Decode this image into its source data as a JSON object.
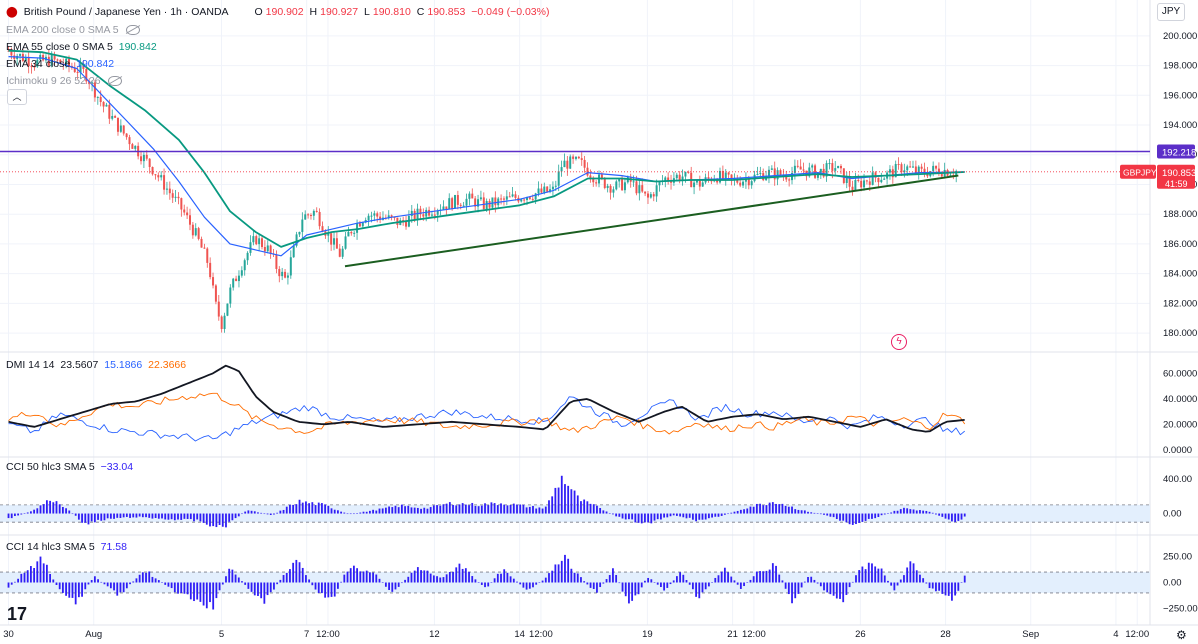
{
  "header": {
    "symbol_title": "British Pound / Japanese Yen · 1h · OANDA",
    "open_label": "O",
    "open_value": "190.902",
    "high_label": "H",
    "high_value": "190.927",
    "low_label": "L",
    "low_value": "190.810",
    "close_label": "C",
    "close_value": "190.853",
    "change": "−0.049 (−0.03%)",
    "currency_button": "JPY"
  },
  "legend": {
    "ema200_label": "EMA 200 close 0 SMA 5",
    "ema55_label": "EMA 55 close 0 SMA 5",
    "ema55_value": "190.842",
    "ema34_label": "EMA 34 close",
    "ema34_value": "190.842",
    "ichimoku_label": "Ichimoku 9 26 52 26",
    "collapse_icon": "chevron-up-icon",
    "visibility_icon": "eye-off-icon"
  },
  "price_axis": {
    "ticks": [
      "200.000",
      "198.000",
      "196.000",
      "194.000",
      "192.000",
      "190.000",
      "188.000",
      "186.000",
      "184.000",
      "182.000",
      "180.000"
    ],
    "tick_values": [
      200,
      198,
      196,
      194,
      192,
      190,
      188,
      186,
      184,
      182,
      180
    ],
    "ylim": [
      179.2,
      201.2
    ],
    "resistance_label": "192.218",
    "resistance_value": 192.218,
    "last_symbol": "GBPJPY",
    "last_price": "190.853",
    "last_price_value": 190.853,
    "countdown": "41:59"
  },
  "dmi": {
    "label": "DMI 14 14",
    "adx": "23.5607",
    "plus_di": "15.1866",
    "minus_di": "22.3666",
    "ticks": [
      "60.0000",
      "40.0000",
      "20.0000",
      "0.0000"
    ],
    "tick_values": [
      60,
      40,
      20,
      0
    ],
    "ylim": [
      -4,
      72
    ]
  },
  "cci50": {
    "label": "CCI 50 hlc3 SMA 5",
    "value": "−33.04",
    "ticks": [
      "400.00",
      "0.00"
    ],
    "tick_values": [
      400,
      0
    ],
    "band": [
      100,
      -100
    ],
    "ylim": [
      -190,
      560
    ]
  },
  "cci14": {
    "label": "CCI 14 hlc3 SMA 5",
    "value": "71.58",
    "ticks": [
      "250.00",
      "0.00",
      "−250.00"
    ],
    "tick_values": [
      250,
      0,
      -250
    ],
    "band": [
      100,
      -100
    ],
    "ylim": [
      -360,
      360
    ]
  },
  "time_axis": {
    "labels": [
      "30",
      "Aug",
      "5",
      "7",
      "12:00",
      "12",
      "14",
      "12:00",
      "19",
      "21",
      "12:00",
      "26",
      "28",
      "Sep",
      "4",
      "12:00"
    ],
    "positions": [
      0,
      2,
      5,
      7,
      7.5,
      10,
      12,
      12.5,
      15,
      17,
      17.5,
      20,
      22,
      24,
      26,
      26.5
    ]
  },
  "chart_data": {
    "type": "candlestick",
    "title": "British Pound / Japanese Yen · 1h · OANDA",
    "x_domain": [
      -0.2,
      26.8
    ],
    "last_bar_x": 22.45,
    "price_anchors": [
      [
        0,
        199.0
      ],
      [
        0.6,
        198.2
      ],
      [
        1.0,
        198.4
      ],
      [
        1.4,
        198.0
      ],
      [
        1.8,
        197.5
      ],
      [
        2.2,
        195.4
      ],
      [
        2.6,
        193.8
      ],
      [
        3.0,
        192.4
      ],
      [
        3.4,
        191.0
      ],
      [
        3.8,
        189.4
      ],
      [
        4.1,
        188.2
      ],
      [
        4.4,
        186.6
      ],
      [
        4.7,
        184.6
      ],
      [
        4.85,
        182.0
      ],
      [
        5.0,
        180.6
      ],
      [
        5.2,
        182.8
      ],
      [
        5.5,
        184.8
      ],
      [
        5.8,
        186.4
      ],
      [
        6.1,
        185.6
      ],
      [
        6.3,
        184.4
      ],
      [
        6.5,
        183.6
      ],
      [
        6.7,
        185.6
      ],
      [
        6.9,
        187.8
      ],
      [
        7.2,
        188.2
      ],
      [
        7.5,
        186.6
      ],
      [
        7.8,
        185.2
      ],
      [
        8.0,
        186.8
      ],
      [
        8.4,
        188.0
      ],
      [
        8.8,
        187.8
      ],
      [
        9.2,
        187.4
      ],
      [
        9.6,
        188.0
      ],
      [
        10.0,
        188.4
      ],
      [
        10.4,
        188.8
      ],
      [
        10.8,
        189.0
      ],
      [
        11.2,
        188.6
      ],
      [
        11.6,
        188.9
      ],
      [
        12.0,
        189.2
      ],
      [
        12.4,
        189.4
      ],
      [
        12.8,
        189.6
      ],
      [
        13.0,
        191.4
      ],
      [
        13.4,
        191.5
      ],
      [
        13.8,
        190.4
      ],
      [
        14.2,
        189.8
      ],
      [
        14.6,
        190.2
      ],
      [
        15.0,
        189.0
      ],
      [
        15.4,
        190.4
      ],
      [
        15.8,
        190.6
      ],
      [
        16.2,
        190.0
      ],
      [
        16.6,
        190.6
      ],
      [
        17.0,
        190.2
      ],
      [
        17.4,
        190.4
      ],
      [
        17.8,
        190.8
      ],
      [
        18.2,
        190.6
      ],
      [
        18.6,
        191.0
      ],
      [
        19.0,
        190.8
      ],
      [
        19.4,
        191.2
      ],
      [
        19.8,
        189.8
      ],
      [
        20.2,
        190.4
      ],
      [
        20.6,
        190.6
      ],
      [
        21.0,
        191.2
      ],
      [
        21.4,
        190.8
      ],
      [
        21.8,
        191.0
      ],
      [
        22.2,
        190.9
      ],
      [
        22.45,
        190.85
      ]
    ],
    "ema34_anchors": [
      [
        0,
        198.6
      ],
      [
        0.8,
        198.5
      ],
      [
        1.6,
        197.8
      ],
      [
        2.2,
        196.0
      ],
      [
        2.8,
        194.2
      ],
      [
        3.4,
        192.4
      ],
      [
        4.0,
        190.2
      ],
      [
        4.6,
        187.8
      ],
      [
        5.2,
        186.0
      ],
      [
        5.8,
        185.6
      ],
      [
        6.4,
        185.2
      ],
      [
        7.0,
        186.6
      ],
      [
        7.6,
        187.0
      ],
      [
        8.2,
        187.4
      ],
      [
        9.0,
        187.8
      ],
      [
        10.0,
        188.2
      ],
      [
        11.0,
        188.6
      ],
      [
        12.0,
        189.0
      ],
      [
        12.8,
        189.6
      ],
      [
        13.6,
        190.8
      ],
      [
        14.4,
        190.6
      ],
      [
        15.2,
        190.2
      ],
      [
        16.0,
        190.3
      ],
      [
        17.0,
        190.4
      ],
      [
        18.0,
        190.6
      ],
      [
        19.0,
        190.8
      ],
      [
        19.8,
        190.4
      ],
      [
        20.6,
        190.6
      ],
      [
        21.4,
        190.8
      ],
      [
        22.45,
        190.85
      ]
    ],
    "ema55_anchors": [
      [
        0,
        199.0
      ],
      [
        0.8,
        198.9
      ],
      [
        1.6,
        198.4
      ],
      [
        2.4,
        196.6
      ],
      [
        3.2,
        195.0
      ],
      [
        4.0,
        193.0
      ],
      [
        4.6,
        190.8
      ],
      [
        5.2,
        188.2
      ],
      [
        5.8,
        186.8
      ],
      [
        6.4,
        185.8
      ],
      [
        7.0,
        186.4
      ],
      [
        7.6,
        186.8
      ],
      [
        8.2,
        187.0
      ],
      [
        9.0,
        187.4
      ],
      [
        10.0,
        187.8
      ],
      [
        11.0,
        188.2
      ],
      [
        12.0,
        188.6
      ],
      [
        12.8,
        189.2
      ],
      [
        13.6,
        190.4
      ],
      [
        14.4,
        190.4
      ],
      [
        15.2,
        190.2
      ],
      [
        16.0,
        190.3
      ],
      [
        17.0,
        190.3
      ],
      [
        18.0,
        190.5
      ],
      [
        19.0,
        190.7
      ],
      [
        19.8,
        190.5
      ],
      [
        20.6,
        190.6
      ],
      [
        21.4,
        190.7
      ],
      [
        22.45,
        190.84
      ]
    ],
    "trendline": [
      [
        7.9,
        184.5
      ],
      [
        22.3,
        190.6
      ]
    ],
    "resistance": 192.218,
    "dmi_adx": [
      [
        0,
        22
      ],
      [
        0.6,
        18
      ],
      [
        1.2,
        24
      ],
      [
        1.8,
        30
      ],
      [
        2.4,
        36
      ],
      [
        3.0,
        38
      ],
      [
        3.6,
        44
      ],
      [
        4.2,
        52
      ],
      [
        4.8,
        60
      ],
      [
        5.1,
        66
      ],
      [
        5.4,
        62
      ],
      [
        5.8,
        42
      ],
      [
        6.2,
        30
      ],
      [
        6.8,
        22
      ],
      [
        7.4,
        20
      ],
      [
        8.0,
        22
      ],
      [
        8.8,
        18
      ],
      [
        9.6,
        20
      ],
      [
        10.4,
        22
      ],
      [
        11.2,
        20
      ],
      [
        12.0,
        18
      ],
      [
        12.6,
        16
      ],
      [
        13.2,
        38
      ],
      [
        13.6,
        40
      ],
      [
        14.2,
        30
      ],
      [
        14.8,
        22
      ],
      [
        15.4,
        30
      ],
      [
        15.8,
        34
      ],
      [
        16.4,
        22
      ],
      [
        17.0,
        26
      ],
      [
        17.6,
        28
      ],
      [
        18.2,
        24
      ],
      [
        18.8,
        26
      ],
      [
        19.4,
        22
      ],
      [
        20.0,
        18
      ],
      [
        20.6,
        24
      ],
      [
        21.2,
        16
      ],
      [
        21.6,
        14
      ],
      [
        22.0,
        22
      ],
      [
        22.45,
        23.5
      ]
    ],
    "dmi_plus": [
      [
        0,
        20
      ],
      [
        0.6,
        14
      ],
      [
        1.2,
        28
      ],
      [
        1.8,
        22
      ],
      [
        2.4,
        16
      ],
      [
        3.0,
        14
      ],
      [
        3.6,
        12
      ],
      [
        4.2,
        10
      ],
      [
        4.8,
        8
      ],
      [
        5.2,
        14
      ],
      [
        5.8,
        22
      ],
      [
        6.4,
        28
      ],
      [
        7.0,
        34
      ],
      [
        7.6,
        26
      ],
      [
        8.2,
        24
      ],
      [
        8.8,
        22
      ],
      [
        9.6,
        26
      ],
      [
        10.4,
        30
      ],
      [
        11.2,
        26
      ],
      [
        12.0,
        24
      ],
      [
        12.6,
        22
      ],
      [
        13.2,
        42
      ],
      [
        13.8,
        30
      ],
      [
        14.4,
        20
      ],
      [
        15.0,
        30
      ],
      [
        15.6,
        38
      ],
      [
        16.2,
        24
      ],
      [
        16.8,
        34
      ],
      [
        17.4,
        28
      ],
      [
        18.0,
        30
      ],
      [
        18.6,
        22
      ],
      [
        19.2,
        26
      ],
      [
        19.8,
        18
      ],
      [
        20.4,
        26
      ],
      [
        21.0,
        20
      ],
      [
        21.6,
        24
      ],
      [
        22.0,
        14
      ],
      [
        22.45,
        15.2
      ]
    ],
    "dmi_minus": [
      [
        0,
        24
      ],
      [
        0.6,
        30
      ],
      [
        1.2,
        18
      ],
      [
        1.8,
        28
      ],
      [
        2.4,
        36
      ],
      [
        3.0,
        34
      ],
      [
        3.6,
        38
      ],
      [
        4.2,
        42
      ],
      [
        4.8,
        44
      ],
      [
        5.2,
        38
      ],
      [
        5.8,
        24
      ],
      [
        6.4,
        18
      ],
      [
        7.0,
        14
      ],
      [
        7.6,
        20
      ],
      [
        8.2,
        22
      ],
      [
        8.8,
        24
      ],
      [
        9.6,
        22
      ],
      [
        10.4,
        18
      ],
      [
        11.2,
        20
      ],
      [
        12.0,
        22
      ],
      [
        12.6,
        24
      ],
      [
        13.2,
        14
      ],
      [
        13.8,
        20
      ],
      [
        14.4,
        26
      ],
      [
        15.0,
        18
      ],
      [
        15.6,
        14
      ],
      [
        16.2,
        22
      ],
      [
        16.8,
        16
      ],
      [
        17.4,
        20
      ],
      [
        18.0,
        18
      ],
      [
        18.6,
        24
      ],
      [
        19.2,
        20
      ],
      [
        19.8,
        26
      ],
      [
        20.4,
        20
      ],
      [
        21.0,
        24
      ],
      [
        21.6,
        18
      ],
      [
        22.0,
        28
      ],
      [
        22.45,
        22.4
      ]
    ],
    "cci50_anchors": [
      [
        0,
        -60
      ],
      [
        0.6,
        40
      ],
      [
        1.0,
        170
      ],
      [
        1.4,
        40
      ],
      [
        1.8,
        -120
      ],
      [
        2.4,
        -60
      ],
      [
        3.0,
        -40
      ],
      [
        3.6,
        -60
      ],
      [
        4.4,
        -80
      ],
      [
        5.0,
        -170
      ],
      [
        5.6,
        40
      ],
      [
        6.2,
        -20
      ],
      [
        6.8,
        140
      ],
      [
        7.4,
        100
      ],
      [
        8.0,
        -10
      ],
      [
        8.6,
        40
      ],
      [
        9.2,
        90
      ],
      [
        9.8,
        60
      ],
      [
        10.4,
        120
      ],
      [
        11.0,
        100
      ],
      [
        11.6,
        120
      ],
      [
        12.2,
        80
      ],
      [
        12.6,
        60
      ],
      [
        13.0,
        420
      ],
      [
        13.4,
        160
      ],
      [
        13.8,
        80
      ],
      [
        14.4,
        -60
      ],
      [
        15.0,
        -120
      ],
      [
        15.6,
        -20
      ],
      [
        16.2,
        -80
      ],
      [
        16.8,
        -20
      ],
      [
        17.4,
        80
      ],
      [
        18.0,
        140
      ],
      [
        18.6,
        40
      ],
      [
        19.2,
        -20
      ],
      [
        19.8,
        -120
      ],
      [
        20.4,
        -40
      ],
      [
        21.0,
        60
      ],
      [
        21.6,
        30
      ],
      [
        22.0,
        -60
      ],
      [
        22.2,
        -120
      ],
      [
        22.45,
        -33
      ]
    ],
    "cci14_anchors": [
      [
        0,
        -60
      ],
      [
        0.4,
        120
      ],
      [
        0.8,
        220
      ],
      [
        1.2,
        -80
      ],
      [
        1.6,
        -200
      ],
      [
        2.0,
        60
      ],
      [
        2.6,
        -120
      ],
      [
        3.2,
        120
      ],
      [
        3.8,
        -60
      ],
      [
        4.4,
        -180
      ],
      [
        4.8,
        -240
      ],
      [
        5.2,
        140
      ],
      [
        5.6,
        -40
      ],
      [
        6.0,
        -200
      ],
      [
        6.4,
        40
      ],
      [
        6.8,
        220
      ],
      [
        7.2,
        -80
      ],
      [
        7.6,
        -160
      ],
      [
        8.0,
        160
      ],
      [
        8.6,
        80
      ],
      [
        9.0,
        -100
      ],
      [
        9.6,
        140
      ],
      [
        10.2,
        40
      ],
      [
        10.6,
        180
      ],
      [
        11.2,
        -60
      ],
      [
        11.6,
        120
      ],
      [
        12.2,
        -80
      ],
      [
        12.6,
        40
      ],
      [
        13.0,
        260
      ],
      [
        13.4,
        60
      ],
      [
        13.8,
        -100
      ],
      [
        14.2,
        120
      ],
      [
        14.6,
        -240
      ],
      [
        15.0,
        60
      ],
      [
        15.4,
        -80
      ],
      [
        15.8,
        100
      ],
      [
        16.2,
        -160
      ],
      [
        16.8,
        140
      ],
      [
        17.2,
        -60
      ],
      [
        17.6,
        100
      ],
      [
        18.0,
        180
      ],
      [
        18.4,
        -200
      ],
      [
        18.8,
        80
      ],
      [
        19.2,
        -100
      ],
      [
        19.6,
        -160
      ],
      [
        20.0,
        140
      ],
      [
        20.4,
        180
      ],
      [
        20.8,
        -80
      ],
      [
        21.2,
        200
      ],
      [
        21.6,
        -40
      ],
      [
        22.0,
        -120
      ],
      [
        22.2,
        -160
      ],
      [
        22.45,
        72
      ]
    ],
    "colors": {
      "up": "#26a69a",
      "down": "#ef5350",
      "ema34": "#2962ff",
      "ema55": "#089981",
      "resistance": "#5b2ec8",
      "trendline": "#1b5e20",
      "price_line": "#f23645",
      "adx": "#131722",
      "plus_di": "#2962ff",
      "minus_di": "#ff6d00",
      "cci": "#2f1df5",
      "band": "#e3effd"
    }
  }
}
